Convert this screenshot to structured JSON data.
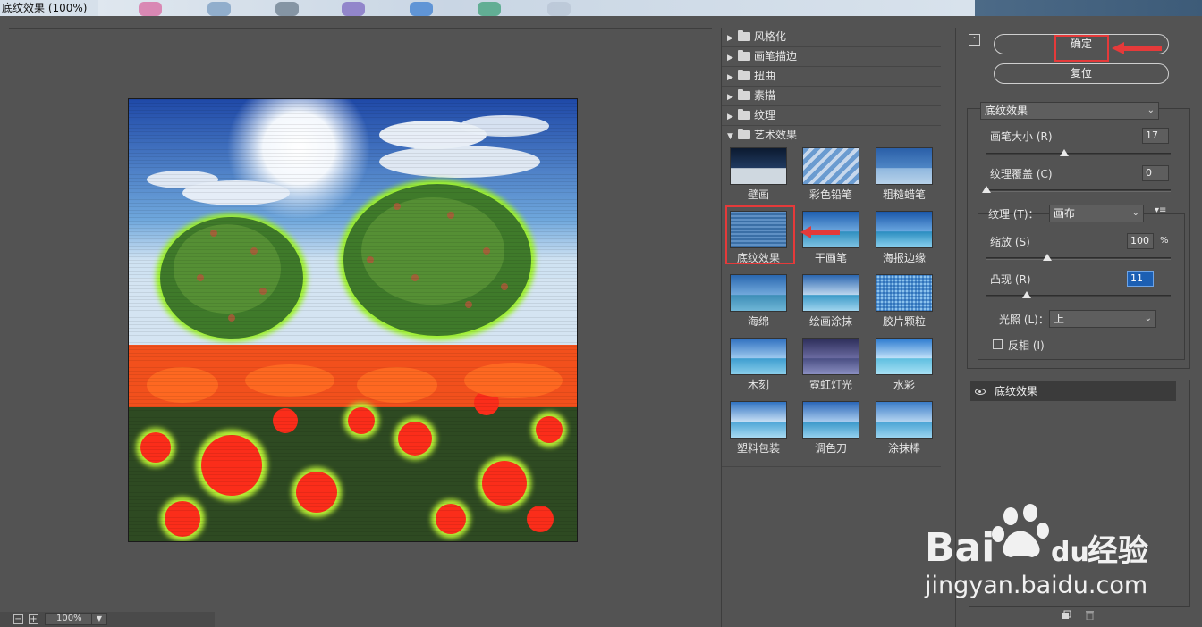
{
  "window": {
    "title": "底纹效果 (100%)"
  },
  "canvas": {
    "zoom": "100%",
    "zoom_out": "−",
    "zoom_in": "+"
  },
  "gallery": {
    "categories": [
      {
        "label": "风格化",
        "expanded": false
      },
      {
        "label": "画笔描边",
        "expanded": false
      },
      {
        "label": "扭曲",
        "expanded": false
      },
      {
        "label": "素描",
        "expanded": false
      },
      {
        "label": "纹理",
        "expanded": false
      },
      {
        "label": "艺术效果",
        "expanded": true
      }
    ],
    "filters": [
      "壁画",
      "彩色铅笔",
      "粗糙蜡笔",
      "底纹效果",
      "干画笔",
      "海报边缘",
      "海绵",
      "绘画涂抹",
      "胶片颗粒",
      "木刻",
      "霓虹灯光",
      "水彩",
      "塑料包装",
      "调色刀",
      "涂抹棒"
    ],
    "selected_filter": "底纹效果"
  },
  "actions": {
    "ok_label": "确定",
    "reset_label": "复位"
  },
  "settings": {
    "filter_select": "底纹效果",
    "brush_size": {
      "label": "画笔大小 (R)",
      "value": "17",
      "fraction": 0.42
    },
    "texture_coverage": {
      "label": "纹理覆盖 (C)",
      "value": "0",
      "fraction": 0.0
    },
    "texture": {
      "label": "纹理 (T)：",
      "value": "画布"
    },
    "scaling": {
      "label": "缩放 (S)",
      "value": "100",
      "unit": "%",
      "fraction": 0.33
    },
    "relief": {
      "label": "凸现 (R)",
      "value": "11",
      "fraction": 0.22
    },
    "light": {
      "label": "光照 (L)：",
      "value": "上"
    },
    "invert": {
      "label": "反相 (I)",
      "checked": false
    }
  },
  "layers": {
    "items": [
      {
        "name": "底纹效果",
        "visible": true
      }
    ]
  },
  "watermark": {
    "brand": "Bai",
    "brand2": "du",
    "cn": "经验",
    "url": "jingyan.baidu.com"
  },
  "colors": {
    "panel": "#535353",
    "highlight": "#e53a3a",
    "active_input": "#1c5fb3"
  }
}
